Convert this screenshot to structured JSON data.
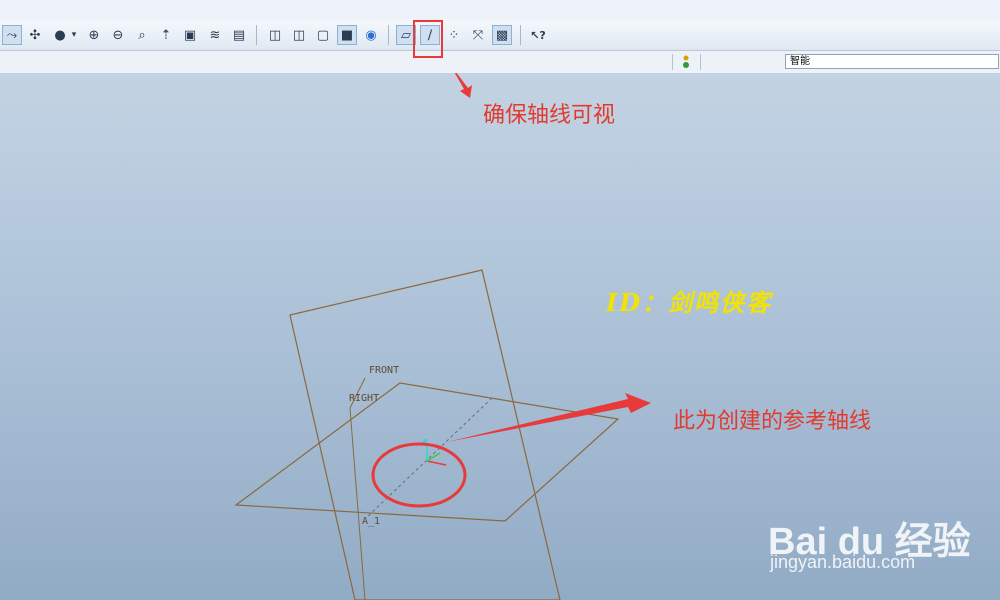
{
  "toolbar": {
    "buttons": [
      {
        "name": "repaint-icon",
        "glyph": "⤳",
        "pressed": true
      },
      {
        "name": "spin-center-icon",
        "glyph": "✣"
      },
      {
        "name": "orient-mode-icon",
        "glyph": "●"
      },
      {
        "name": "dropdown-arrow-icon",
        "glyph": "▾"
      },
      {
        "name": "zoom-in-icon",
        "glyph": "⊕"
      },
      {
        "name": "zoom-out-icon",
        "glyph": "⊖"
      },
      {
        "name": "refit-icon",
        "glyph": "⌕"
      },
      {
        "name": "reorient-icon",
        "glyph": "⇡"
      },
      {
        "name": "saved-views-icon",
        "glyph": "▣"
      },
      {
        "name": "layers-icon",
        "glyph": "≋"
      },
      {
        "name": "view-manager-icon",
        "glyph": "▤"
      },
      {
        "name": "wireframe-icon",
        "glyph": "◫"
      },
      {
        "name": "hidden-line-icon",
        "glyph": "◫"
      },
      {
        "name": "no-hidden-icon",
        "glyph": "▢"
      },
      {
        "name": "shading-icon",
        "glyph": "■",
        "pressed": true
      },
      {
        "name": "appearance-icon",
        "glyph": "◉"
      },
      {
        "name": "datum-planes-icon",
        "glyph": "▱",
        "pressed": true
      },
      {
        "name": "datum-axes-icon",
        "glyph": "∕",
        "pressed": true
      },
      {
        "name": "datum-points-icon",
        "glyph": "⁘"
      },
      {
        "name": "coordinate-systems-icon",
        "glyph": "⤧"
      },
      {
        "name": "annotations-icon",
        "glyph": "▩",
        "pressed": true
      },
      {
        "name": "context-help-icon",
        "glyph": "↖?"
      }
    ]
  },
  "status": {
    "filter_value": "智能"
  },
  "annotations": {
    "axis_visibility_note": "确保轴线可视",
    "reference_axis_note": "此为创建的参考轴线",
    "id_mark": "ID：剑鸣侠客"
  },
  "planes": {
    "front": "FRONT",
    "right": "RIGHT",
    "axis": "A_1"
  },
  "watermark": {
    "logo": "Bai du 经验",
    "url": "jingyan.baidu.com"
  },
  "colors": {
    "annotation": "#e23b2e",
    "plane_edge": "#8a6a3c",
    "id_mark": "#f2e300"
  }
}
